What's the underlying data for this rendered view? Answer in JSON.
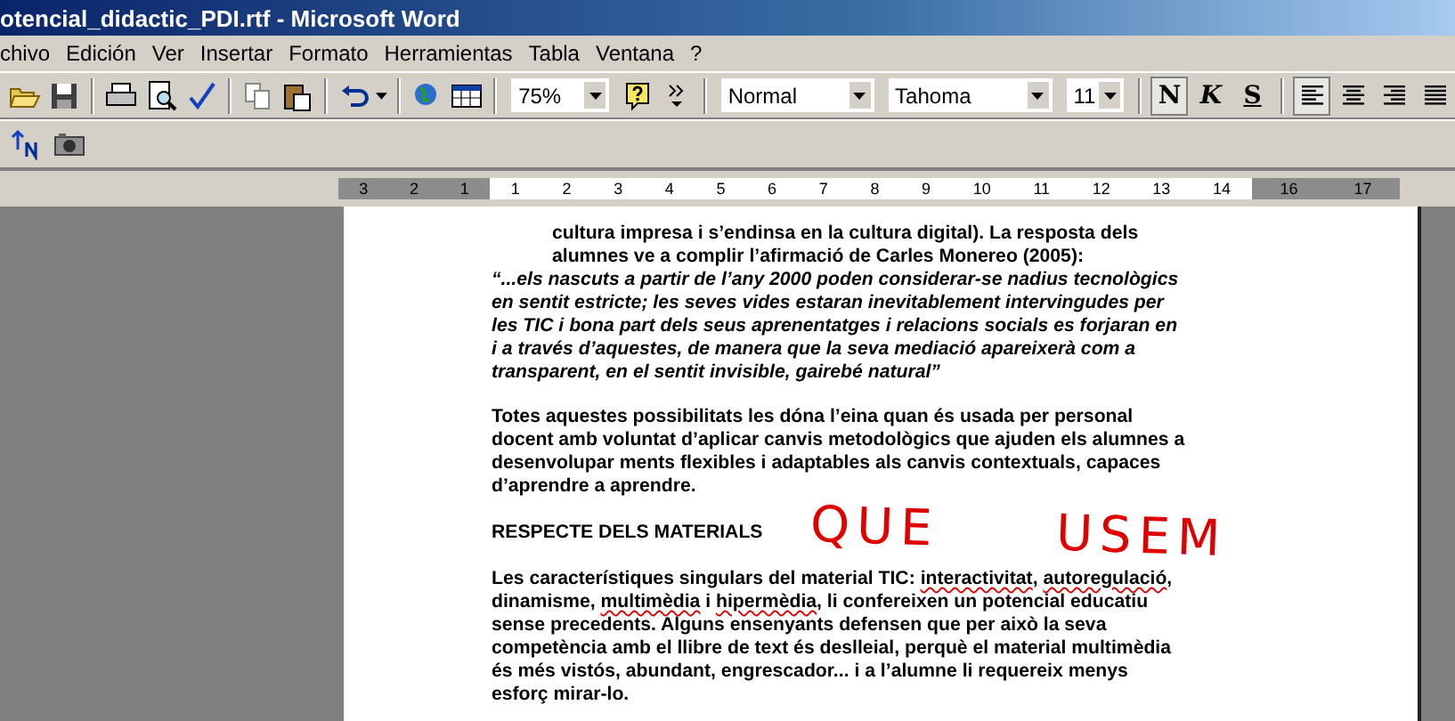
{
  "window": {
    "title": "otencial_didactic_PDI.rtf - Microsoft Word"
  },
  "menu": [
    {
      "label": "chivo"
    },
    {
      "label": "Edición"
    },
    {
      "label": "Ver"
    },
    {
      "label": "Insertar"
    },
    {
      "label": "Formato"
    },
    {
      "label": "Herramientas"
    },
    {
      "label": "Tabla"
    },
    {
      "label": "Ventana"
    },
    {
      "label": "?"
    }
  ],
  "toolbar": {
    "zoom": "75%",
    "style": "Normal",
    "font": "Tahoma",
    "size": "11",
    "format_buttons": [
      {
        "label": "N",
        "kind": "bold",
        "selected": true
      },
      {
        "label": "K",
        "kind": "italic",
        "selected": false
      },
      {
        "label": "S",
        "kind": "underline",
        "selected": false
      }
    ],
    "alignment": [
      {
        "kind": "left",
        "selected": true
      },
      {
        "kind": "center",
        "selected": false
      },
      {
        "kind": "right",
        "selected": false
      },
      {
        "kind": "justify",
        "selected": false
      }
    ]
  },
  "ruler": {
    "left_labels": [
      "3",
      "2",
      "1"
    ],
    "labels": [
      "1",
      "2",
      "3",
      "4",
      "5",
      "6",
      "7",
      "8",
      "9",
      "10",
      "11",
      "12",
      "13",
      "14"
    ],
    "right_labels": [
      "16",
      "17"
    ]
  },
  "document": {
    "blocks": [
      {
        "kind": "indented",
        "lines": [
          "cultura impresa i s’endinsa en la cultura digital). La resposta dels",
          "alumnes ve a complir l’afirmació de Carles Monereo (2005):"
        ]
      },
      {
        "kind": "quote",
        "lines": [
          "“...els nascuts a partir de l’any 2000 poden considerar-se nadius tecnològics",
          "en sentit estricte; les seves vides estaran inevitablement intervingudes per",
          "les TIC i bona part dels seus aprenentatges i relacions socials es forjaran en",
          "i a través d’aquestes, de manera que la seva mediació apareixerà com a",
          "transparent, en el sentit invisible, gairebé natural”"
        ]
      },
      {
        "kind": "paragraph",
        "lines": [
          "Totes aquestes possibilitats les dóna l’eina quan és usada per personal",
          "docent amb voluntat d’aplicar canvis metodològics que ajuden els alumnes a",
          "desenvolupar ments flexibles i adaptables als canvis contextuals, capaces",
          "d’aprendre a aprendre."
        ]
      },
      {
        "kind": "heading",
        "lines": [
          "RESPECTE DELS MATERIALS"
        ]
      },
      {
        "kind": "paragraph",
        "lines": [
          [
            {
              "text": "Les característiques singulars del material TIC: ",
              "misspelled": false
            },
            {
              "text": "interactivitat",
              "misspelled": true
            },
            {
              "text": ", ",
              "misspelled": false
            },
            {
              "text": "autoregulació",
              "misspelled": true
            },
            {
              "text": ",",
              "misspelled": false
            }
          ],
          [
            {
              "text": "dinamisme, ",
              "misspelled": false
            },
            {
              "text": "multimèdia",
              "misspelled": true
            },
            {
              "text": " i ",
              "misspelled": false
            },
            {
              "text": "hipermèdia",
              "misspelled": true
            },
            {
              "text": ", li confereixen un potencial educatiu",
              "misspelled": false
            }
          ],
          "sense precedents. Alguns ensenyants defensen que per això la seva",
          "competència amb el llibre de text és deslleial, perquè el material multimèdia",
          "és més vistós, abundant, engrescador... i a l’alumne li requereix menys",
          "esforç mirar-lo."
        ]
      }
    ],
    "ink_annotation": "QUE  USEM"
  }
}
